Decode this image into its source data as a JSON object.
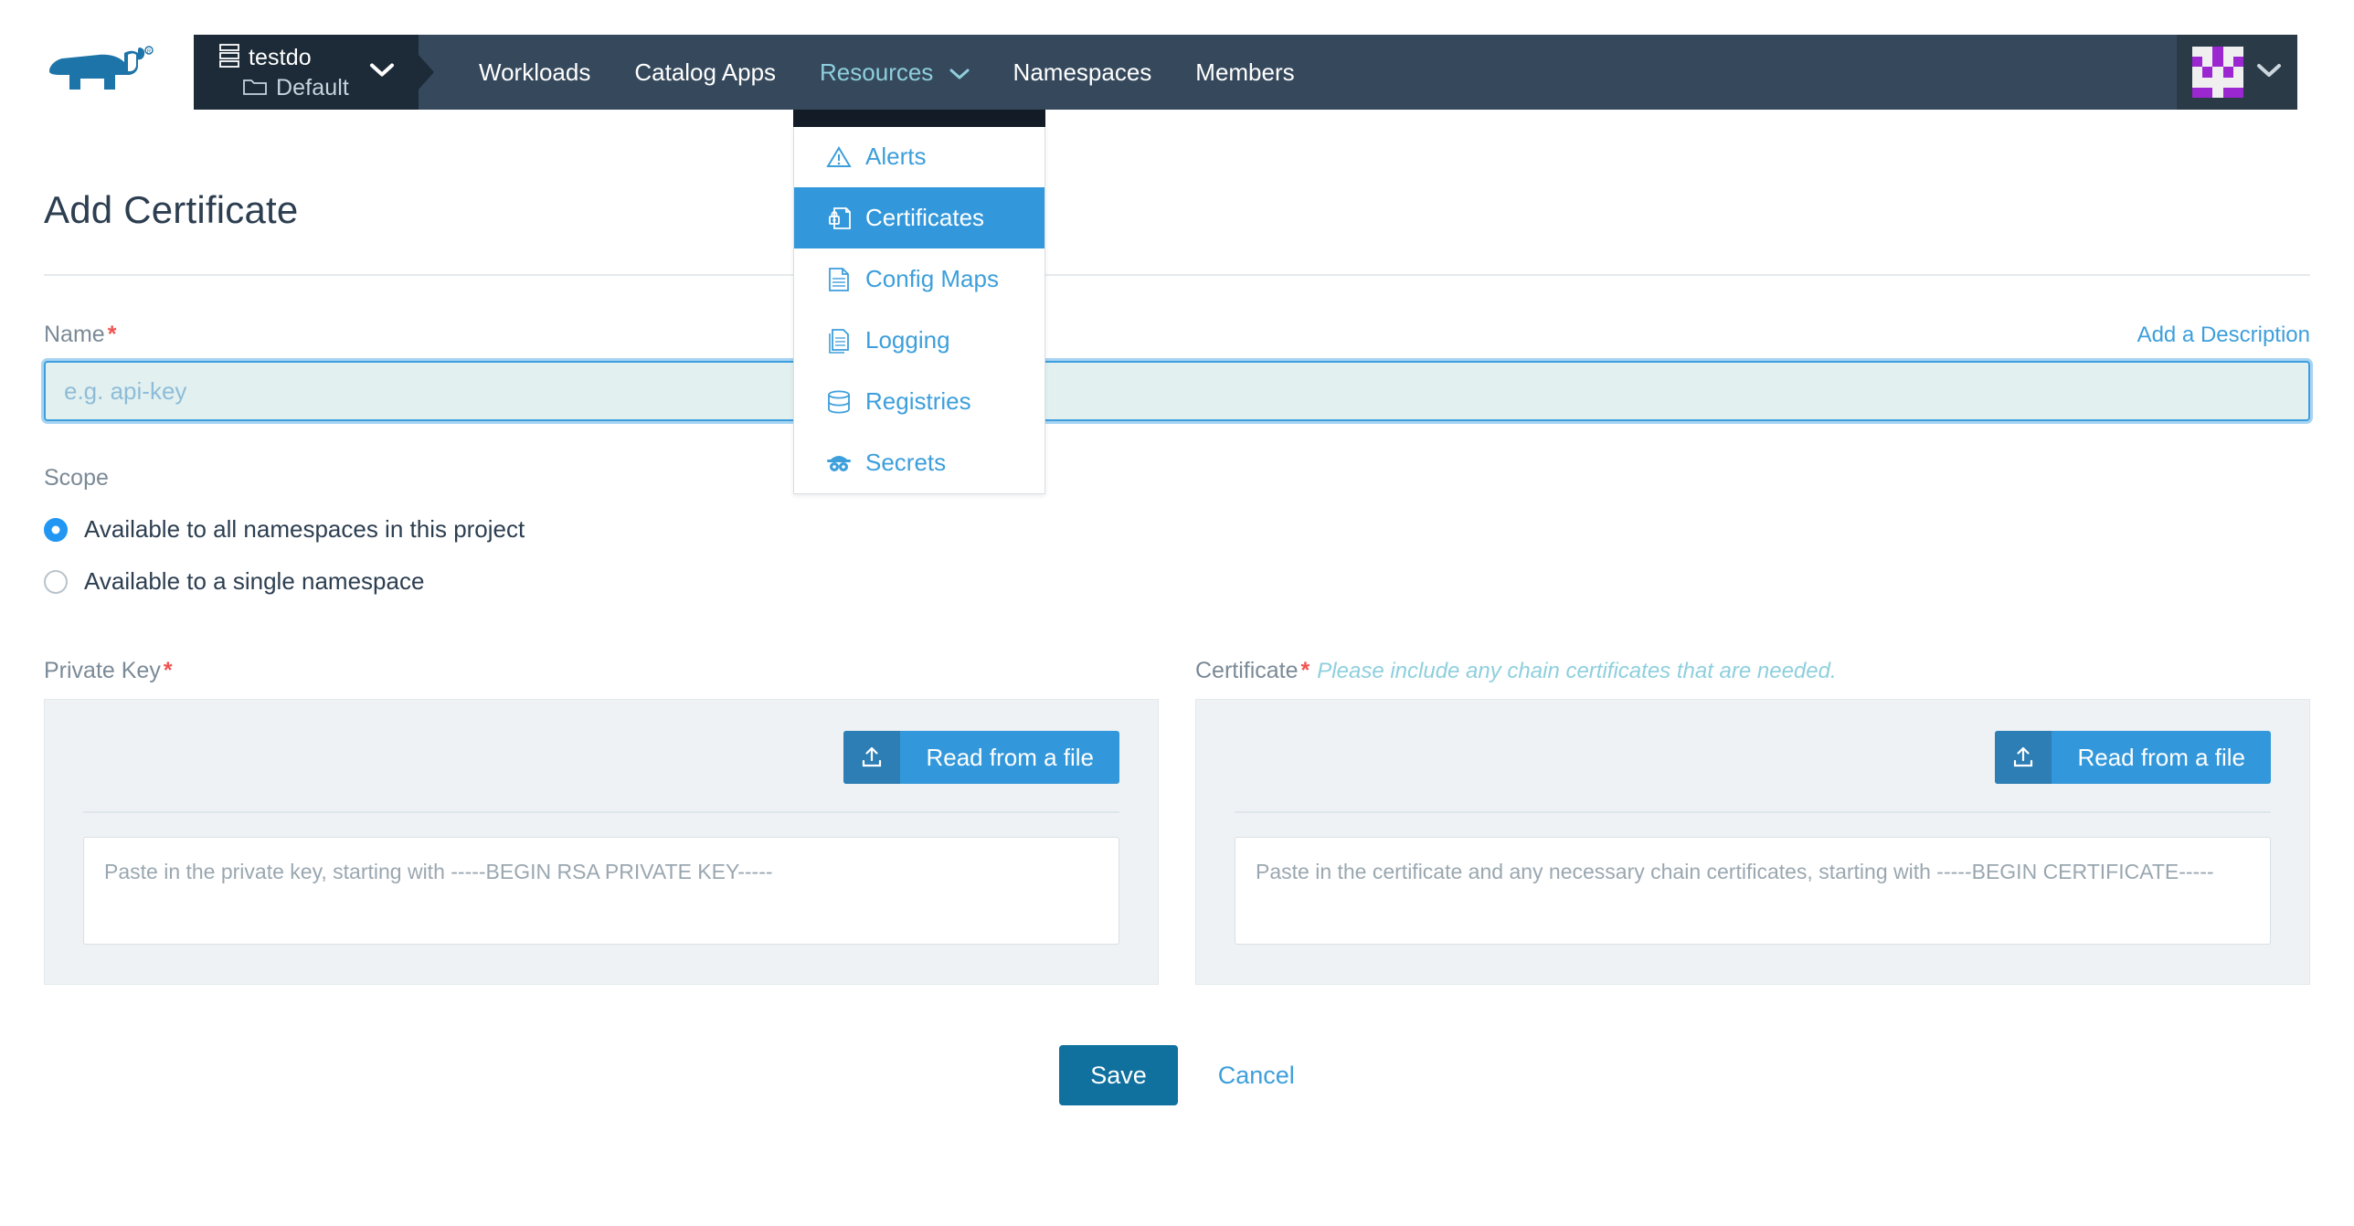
{
  "brand": {
    "logo_name": "rancher-cow-logo",
    "logo_color": "#1d74a8"
  },
  "navbar": {
    "cluster": {
      "name": "testdo",
      "icon": "server-icon"
    },
    "project": {
      "name": "Default",
      "icon": "folder-icon"
    },
    "selector_chevron": "⌄",
    "links": [
      {
        "label": "Workloads",
        "active": false
      },
      {
        "label": "Catalog Apps",
        "active": false
      },
      {
        "label": "Resources",
        "active": true,
        "has_chevron": true
      },
      {
        "label": "Namespaces",
        "active": false
      },
      {
        "label": "Members",
        "active": false
      }
    ],
    "active_color": "#8ecfdd",
    "background": "#36495c",
    "avatar": {
      "name": "user-avatar-identicon",
      "color": "#9b27d0"
    }
  },
  "dropdown": {
    "items": [
      {
        "label": "Alerts",
        "icon": "alert-triangle-icon",
        "selected": false
      },
      {
        "label": "Certificates",
        "icon": "certificate-lock-icon",
        "selected": true
      },
      {
        "label": "Config Maps",
        "icon": "config-map-document-icon",
        "selected": false
      },
      {
        "label": "Logging",
        "icon": "logging-documents-icon",
        "selected": false
      },
      {
        "label": "Registries",
        "icon": "registry-database-icon",
        "selected": false
      },
      {
        "label": "Secrets",
        "icon": "secret-spy-icon",
        "selected": false
      }
    ],
    "selected_color": "#3398db"
  },
  "page": {
    "title": "Add Certificate"
  },
  "name_field": {
    "label": "Name",
    "required_marker": "*",
    "placeholder": "e.g. api-key",
    "value": "",
    "add_description_link": "Add a Description"
  },
  "scope": {
    "label": "Scope",
    "options": [
      {
        "label": "Available to all namespaces in this project",
        "checked": true
      },
      {
        "label": "Available to a single namespace",
        "checked": false
      }
    ]
  },
  "private_key": {
    "label": "Private Key",
    "required_marker": "*",
    "read_button": "Read from a file",
    "read_button_icon": "upload-icon",
    "placeholder": "Paste in the private key, starting with -----BEGIN RSA PRIVATE KEY-----",
    "value": ""
  },
  "certificate": {
    "label": "Certificate",
    "required_marker": "*",
    "hint": "Please include any chain certificates that are needed.",
    "read_button": "Read from a file",
    "read_button_icon": "upload-icon",
    "placeholder": "Paste in the certificate and any necessary chain certificates, starting with -----BEGIN CERTIFICATE-----",
    "value": ""
  },
  "footer": {
    "save_label": "Save",
    "cancel_label": "Cancel",
    "save_color": "#10709e"
  }
}
